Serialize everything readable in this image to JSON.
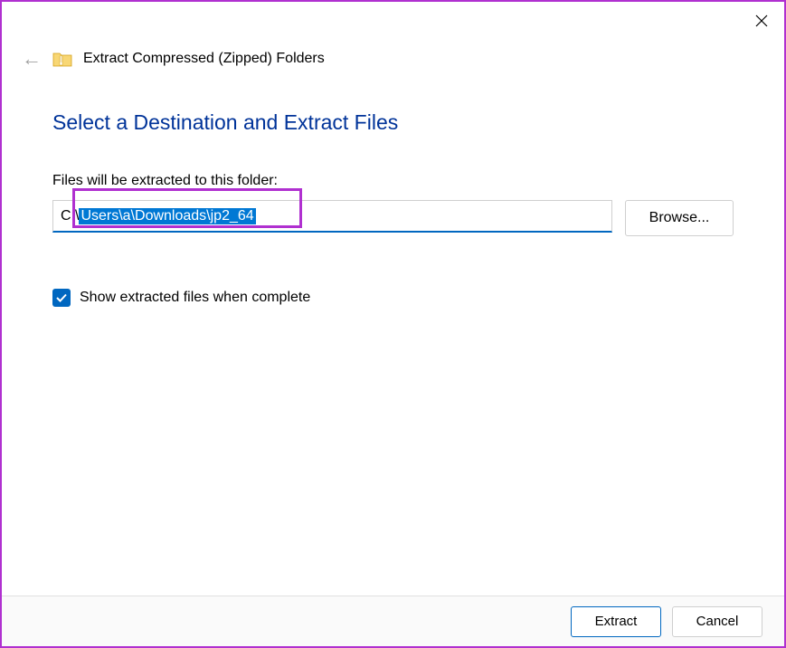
{
  "window": {
    "title": "Extract Compressed (Zipped) Folders"
  },
  "page": {
    "heading": "Select a Destination and Extract Files",
    "field_label": "Files will be extracted to this folder:",
    "path_prefix": "C:\\",
    "path_selected": "Users\\a\\Downloads\\jp2_64",
    "browse_label": "Browse...",
    "checkbox_checked": true,
    "checkbox_label": "Show extracted files when complete"
  },
  "footer": {
    "extract_label": "Extract",
    "cancel_label": "Cancel"
  },
  "annotations": {
    "highlight_path_segment": true
  }
}
